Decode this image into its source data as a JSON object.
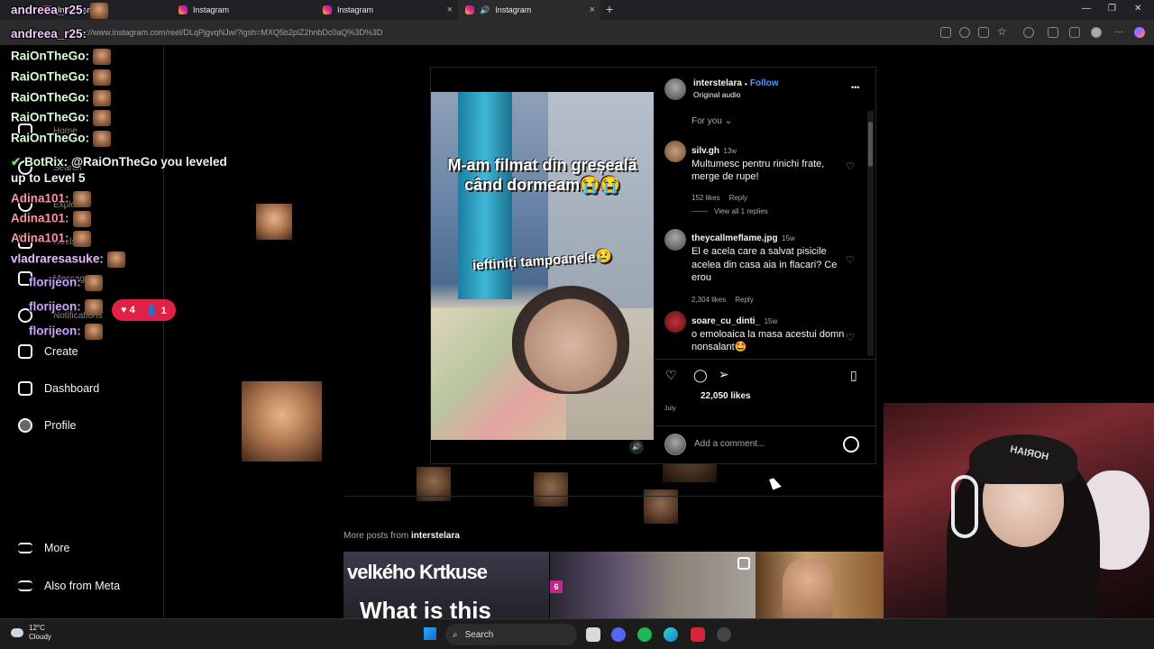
{
  "browser": {
    "tabs": [
      {
        "label": "Instagram"
      },
      {
        "label": "Instagram"
      },
      {
        "label": "Instagram"
      },
      {
        "label": "Instagram"
      }
    ],
    "new_tab": "+",
    "url": "https://www.instagram.com/reel/DLqPjgvqNJw/?igsh=MXQ5b2plZ2hnbDc0aQ%3D%3D",
    "window_controls": {
      "minimize": "—",
      "restore": "❐",
      "close": "✕"
    }
  },
  "sidebar": {
    "items": [
      {
        "label": "Home",
        "icon": "home-icon"
      },
      {
        "label": "Search",
        "icon": "search-icon"
      },
      {
        "label": "Explore",
        "icon": "explore-icon"
      },
      {
        "label": "Reels",
        "icon": "reels-icon"
      },
      {
        "label": "Messages",
        "icon": "messages-icon"
      },
      {
        "label": "Notifications",
        "icon": "heart-icon"
      },
      {
        "label": "Create",
        "icon": "plus-icon"
      },
      {
        "label": "Dashboard",
        "icon": "dashboard-icon"
      },
      {
        "label": "Profile",
        "icon": "profile-icon"
      },
      {
        "label": "More",
        "icon": "menu-icon"
      },
      {
        "label": "Also from Meta",
        "icon": "meta-icon"
      }
    ],
    "notification_pill": {
      "likes": "4",
      "followers": "1"
    }
  },
  "chat": [
    {
      "user": "andreea_r25:",
      "text": ""
    },
    {
      "user": "andreea_r25:",
      "text": ""
    },
    {
      "user": "RaiOnTheGo:",
      "text": ""
    },
    {
      "user": "RaiOnTheGo:",
      "text": ""
    },
    {
      "user": "RaiOnTheGo:",
      "text": ""
    },
    {
      "user": "RaiOnTheGo:",
      "text": ""
    },
    {
      "user": "RaiOnTheGo:",
      "text": ""
    },
    {
      "user": "BotRix:",
      "text": "@RaiOnTheGo you leveled up to Level 5"
    },
    {
      "user": "Adina101:",
      "text": ""
    },
    {
      "user": "Adina101:",
      "text": ""
    },
    {
      "user": "Adina101:",
      "text": ""
    },
    {
      "user": "vladraresasuke:",
      "text": ""
    },
    {
      "user": "florijeon:",
      "text": ""
    },
    {
      "user": "florijeon:",
      "text": ""
    },
    {
      "user": "florijeon:",
      "text": ""
    }
  ],
  "post": {
    "author": "interstelara",
    "follow_label": "Follow",
    "separator": "•",
    "audio": "Original audio",
    "more_icon": "•••",
    "video_caption_1": "M-am filmat din greșeală când dormeam😭😭",
    "video_caption_2": "ieftiniți tampoanele😢",
    "filter": "For you",
    "comments": [
      {
        "user": "silv.gh",
        "time": "13w",
        "text": "Multumesc pentru rinichi frate, merge de rupe!",
        "likes": "152 likes",
        "reply": "Reply",
        "view_replies": "View all 1 replies"
      },
      {
        "user": "theycallmeflame.jpg",
        "time": "15w",
        "text": "El e acela care a salvat pisicile acelea din casa aia in flacari? Ce erou",
        "likes": "2,304 likes",
        "reply": "Reply"
      },
      {
        "user": "soare_cu_dinti_",
        "time": "15w",
        "text": "o emoloaica la masa acestui domn nonsalant🤩"
      }
    ],
    "likes": "22,050 likes",
    "date": "July",
    "comment_placeholder": "Add a comment...",
    "more_posts_prefix": "More posts from",
    "more_posts_user": "interstelara",
    "thumb1_text_1": "velkého Krtkuse",
    "thumb1_text_2": "What is this",
    "thumb2_badge": "6"
  },
  "taskbar": {
    "temp": "12°C",
    "weather": "Cloudy",
    "search_label": "Search"
  },
  "webcam": {
    "cap_text": "НАІЯОН"
  }
}
